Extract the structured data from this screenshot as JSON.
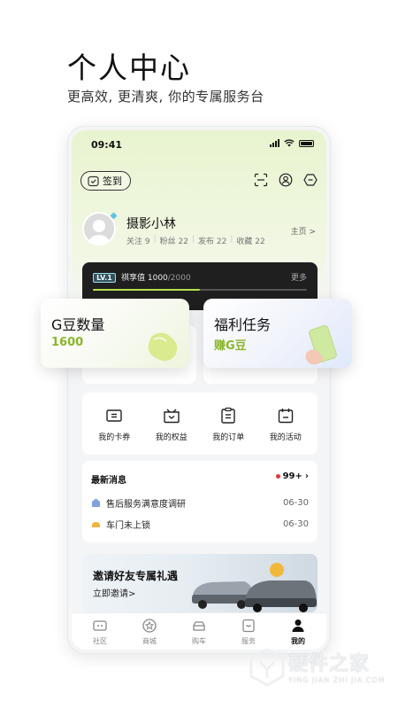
{
  "hero": {
    "title": "个人中心",
    "subtitle": "更高效, 更清爽, 你的专属服务台"
  },
  "status_bar": {
    "time": "09:41"
  },
  "header": {
    "checkin_label": "签到",
    "icons": [
      "scan-icon",
      "user-circle-icon",
      "settings-hex-icon"
    ]
  },
  "profile": {
    "username": "摄影小林",
    "stats": [
      "关注 9",
      "粉丝 22",
      "发布 22",
      "收藏 22"
    ],
    "homepage_label": "主页 >"
  },
  "level": {
    "badge": "LV.1",
    "label": "祺享值 1000",
    "max": "/2000",
    "more": "更多",
    "progress": 0.5
  },
  "cards": {
    "gdou": {
      "title": "G豆数量",
      "value": "1600"
    },
    "welfare": {
      "title": "福利任务",
      "value": "赚G豆"
    }
  },
  "quick_actions": [
    {
      "label": "我的卡券",
      "icon": "coupon-icon"
    },
    {
      "label": "我的权益",
      "icon": "benefits-icon"
    },
    {
      "label": "我的订单",
      "icon": "orders-icon"
    },
    {
      "label": "我的活动",
      "icon": "activity-icon"
    }
  ],
  "messages": {
    "title": "最新消息",
    "count": "99+",
    "items": [
      {
        "text": "售后服务满意度调研",
        "date": "06-30",
        "icon": "survey-icon"
      },
      {
        "text": "车门未上锁",
        "date": "06-30",
        "icon": "car-door-icon"
      }
    ]
  },
  "invite": {
    "title": "邀请好友专属礼遇",
    "link": "立即邀请>"
  },
  "tabs": [
    {
      "label": "社区",
      "icon": "community-icon"
    },
    {
      "label": "商城",
      "icon": "mall-icon"
    },
    {
      "label": "购车",
      "icon": "car-icon"
    },
    {
      "label": "服务",
      "icon": "service-icon"
    },
    {
      "label": "我的",
      "icon": "me-icon",
      "active": true
    }
  ],
  "watermark": {
    "title": "硬件之家",
    "sub": "YING JIAN ZHI JIA.COM"
  },
  "colors": {
    "accent_green": "#8ab62b",
    "dark_card": "#1f1f1f",
    "alert_red": "#e53935"
  }
}
